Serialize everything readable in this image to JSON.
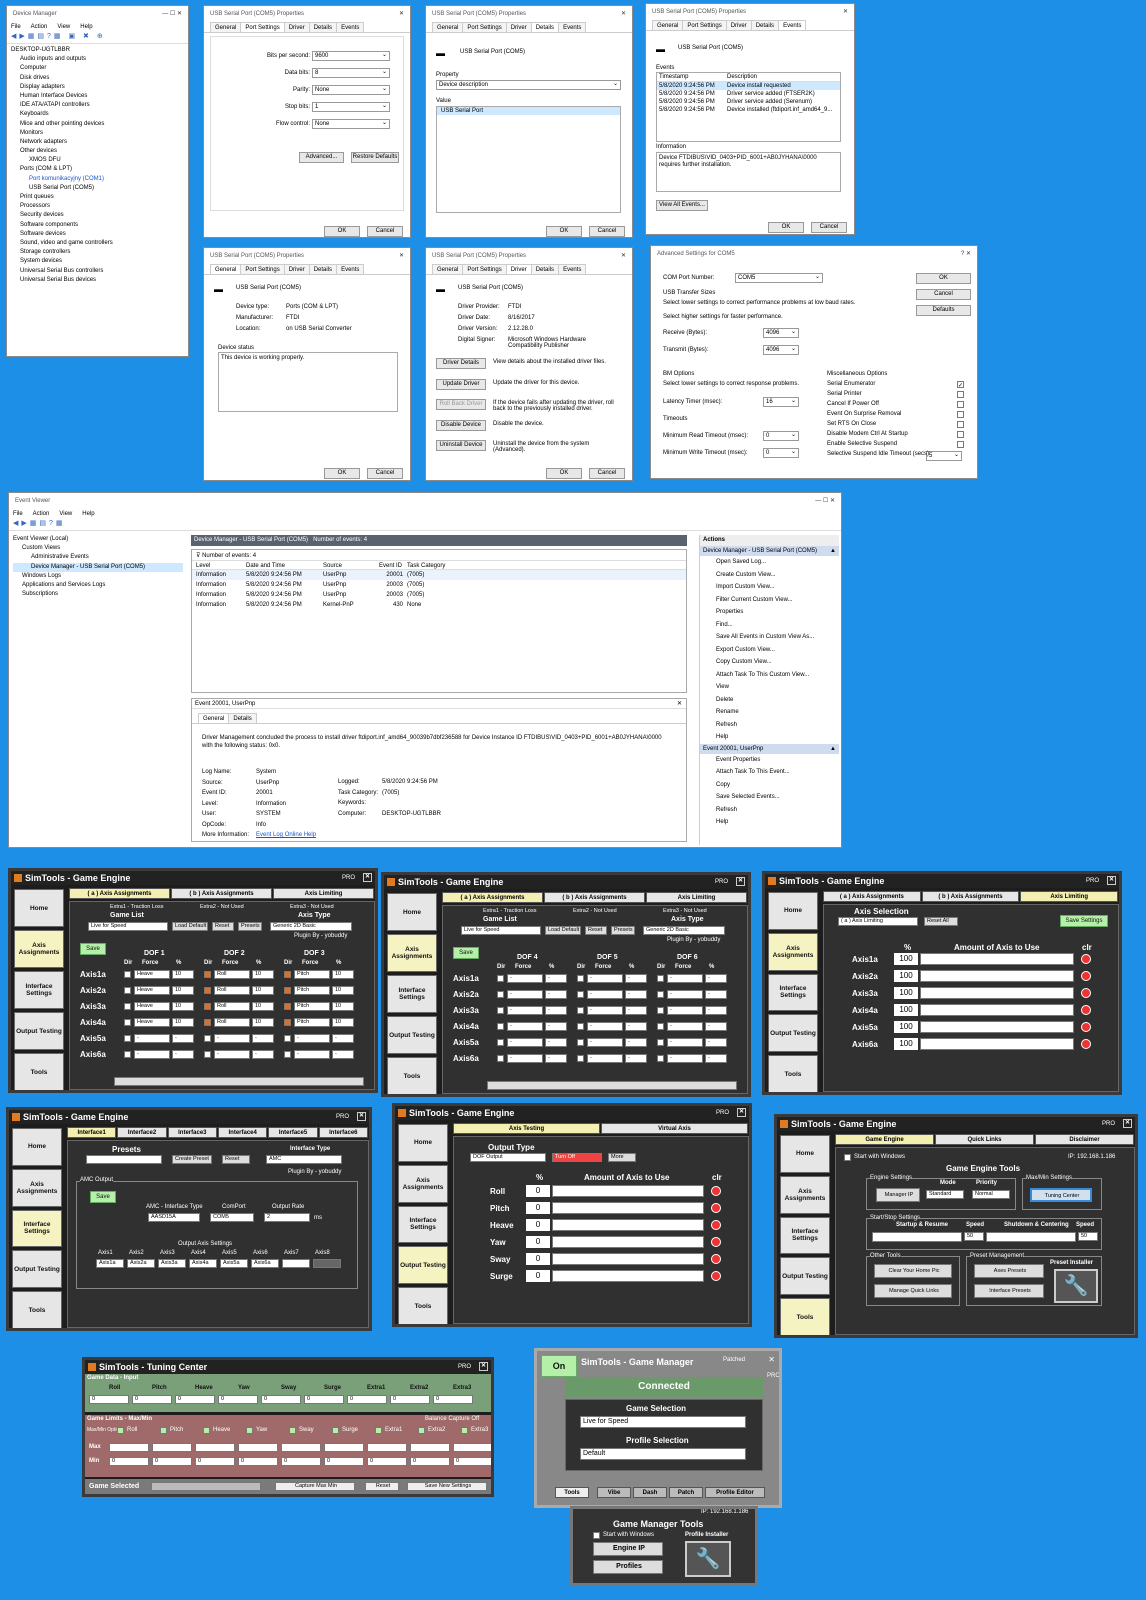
{
  "device_manager": {
    "title": "Device Manager",
    "menu": [
      "File",
      "Action",
      "View",
      "Help"
    ],
    "tree": [
      "DESKTOP-UGTLBBR",
      "Audio inputs and outputs",
      "Computer",
      "Disk drives",
      "Display adapters",
      "Human Interface Devices",
      "IDE ATA/ATAPI controllers",
      "Keyboards",
      "Mice and other pointing devices",
      "Monitors",
      "Network adapters",
      "Other devices",
      "XMOS DFU",
      "Ports (COM & LPT)",
      "Port komunikacyjny (COM1)",
      "USB Serial Port (COM5)",
      "Print queues",
      "Processors",
      "Security devices",
      "Software components",
      "Software devices",
      "Sound, video and game controllers",
      "Storage controllers",
      "System devices",
      "Universal Serial Bus controllers",
      "Universal Serial Bus devices"
    ]
  },
  "props_title": "USB Serial Port (COM5) Properties",
  "prop_tabs": [
    "General",
    "Port Settings",
    "Driver",
    "Details",
    "Events"
  ],
  "ok": "OK",
  "cancel": "Cancel",
  "port_settings": {
    "labels": [
      "Bits per second:",
      "Data bits:",
      "Parity:",
      "Stop bits:",
      "Flow control:"
    ],
    "values": [
      "9600",
      "8",
      "None",
      "1",
      "None"
    ],
    "advanced": "Advanced...",
    "restore": "Restore Defaults"
  },
  "details": {
    "device": "USB Serial Port (COM5)",
    "property_label": "Property",
    "property": "Device description",
    "value_label": "Value",
    "value": "USB Serial Port"
  },
  "events": {
    "device": "USB Serial Port (COM5)",
    "events_label": "Events",
    "col_ts": "Timestamp",
    "col_desc": "Description",
    "rows": [
      [
        "5/8/2020 9:24:56 PM",
        "Device install requested"
      ],
      [
        "5/8/2020 9:24:56 PM",
        "Driver service added (FTSER2K)"
      ],
      [
        "5/8/2020 9:24:56 PM",
        "Driver service added (Serenum)"
      ],
      [
        "5/8/2020 9:24:56 PM",
        "Device installed (ftdiport.inf_amd64_9..."
      ]
    ],
    "info_label": "Information",
    "info": "Device FTDIBUS\\VID_0403+PID_6001+AB0JYHANA\\0000 requires further installation.",
    "view_all": "View All Events..."
  },
  "general": {
    "device": "USB Serial Port (COM5)",
    "labels": [
      "Device type:",
      "Manufacturer:",
      "Location:"
    ],
    "values": [
      "Ports (COM & LPT)",
      "FTDI",
      "on USB Serial Converter"
    ],
    "status_label": "Device status",
    "status": "This device is working properly."
  },
  "driver": {
    "device": "USB Serial Port (COM5)",
    "labels": [
      "Driver Provider:",
      "Driver Date:",
      "Driver Version:",
      "Digital Signer:"
    ],
    "values": [
      "FTDI",
      "8/16/2017",
      "2.12.28.0",
      "Microsoft Windows Hardware Compatibility Publisher"
    ],
    "buttons": [
      "Driver Details",
      "Update Driver",
      "Roll Back Driver",
      "Disable Device",
      "Uninstall Device"
    ],
    "descs": [
      "View details about the installed driver files.",
      "Update the driver for this device.",
      "If the device fails after updating the driver, roll back to the previously installed driver.",
      "Disable the device.",
      "Uninstall the device from the system (Advanced)."
    ]
  },
  "advanced": {
    "title": "Advanced Settings for COM5",
    "com_label": "COM Port Number:",
    "com": "COM5",
    "usb_label": "USB Transfer Sizes",
    "usb_hint1": "Select lower settings to correct performance problems at low baud rates.",
    "usb_hint2": "Select higher settings for faster performance.",
    "receive": "Receive (Bytes):",
    "receive_v": "4096",
    "transmit": "Transmit (Bytes):",
    "transmit_v": "4096",
    "bm_label": "BM Options",
    "bm_hint": "Select lower settings to correct response problems.",
    "latency": "Latency Timer (msec):",
    "latency_v": "16",
    "timeouts": "Timeouts",
    "min_read": "Minimum Read Timeout (msec):",
    "min_read_v": "0",
    "min_write": "Minimum Write Timeout (msec):",
    "min_write_v": "0",
    "misc": "Miscellaneous Options",
    "misc_items": [
      "Serial Enumerator",
      "Serial Printer",
      "Cancel If Power Off",
      "Event On Surprise Removal",
      "Set RTS On Close",
      "Disable Modem Ctrl At Startup",
      "Enable Selective Suspend",
      "Selective Suspend Idle Timeout (secs):"
    ],
    "misc_v": "5",
    "buttons": [
      "OK",
      "Cancel",
      "Defaults"
    ]
  },
  "event_viewer": {
    "title": "Event Viewer",
    "menu": [
      "File",
      "Action",
      "View",
      "Help"
    ],
    "tree": [
      "Event Viewer (Local)",
      "Custom Views",
      "Administrative Events",
      "Device Manager - USB Serial Port (COM5)",
      "Windows Logs",
      "Applications and Services Logs",
      "Subscriptions"
    ],
    "header": "Device Manager - USB Serial Port (COM5)",
    "count_hdr": "Number of events: 4",
    "count": "Number of events: 4",
    "cols": [
      "Level",
      "Date and Time",
      "Source",
      "Event ID",
      "Task Category"
    ],
    "rows": [
      [
        "Information",
        "5/8/2020 9:24:56 PM",
        "UserPnp",
        "20001",
        "(7005)"
      ],
      [
        "Information",
        "5/8/2020 9:24:56 PM",
        "UserPnp",
        "20003",
        "(7005)"
      ],
      [
        "Information",
        "5/8/2020 9:24:56 PM",
        "UserPnp",
        "20003",
        "(7005)"
      ],
      [
        "Information",
        "5/8/2020 9:24:56 PM",
        "Kernel-PnP",
        "430",
        "None"
      ]
    ],
    "detail_title": "Event 20001, UserPnp",
    "detail_tabs": [
      "General",
      "Details"
    ],
    "detail_msg": "Driver Management concluded the process to install driver ftdiport.inf_amd64_90039b7dbf236588 for Device Instance ID FTDIBUS\\VID_0403+PID_6001+AB0JYHANA\\0000 with the following status: 0x0.",
    "fields": [
      [
        "Log Name:",
        "System"
      ],
      [
        "Source:",
        "UserPnp"
      ],
      [
        "Event ID:",
        "20001"
      ],
      [
        "Level:",
        "Information"
      ],
      [
        "User:",
        "SYSTEM"
      ],
      [
        "OpCode:",
        "Info"
      ],
      [
        "More Information:",
        "Event Log Online Help"
      ]
    ],
    "fields2": [
      [
        "Logged:",
        "5/8/2020 9:24:56 PM"
      ],
      [
        "Task Category:",
        "(7005)"
      ],
      [
        "Keywords:",
        ""
      ],
      [
        "Computer:",
        "DESKTOP-UGTLBBR"
      ]
    ],
    "actions_label": "Actions",
    "actions_hdr1": "Device Manager - USB Serial Port (COM5)",
    "actions1": [
      "Open Saved Log...",
      "Create Custom View...",
      "Import Custom View...",
      "Filter Current Custom View...",
      "Properties",
      "Find...",
      "Save All Events in Custom View As...",
      "Export Custom View...",
      "Copy Custom View...",
      "Attach Task To This Custom View...",
      "View",
      "Delete",
      "Rename",
      "Refresh",
      "Help"
    ],
    "actions_hdr2": "Event 20001, UserPnp",
    "actions2": [
      "Event Properties",
      "Attach Task To This Event...",
      "Copy",
      "Save Selected Events...",
      "Refresh",
      "Help"
    ]
  },
  "sim": {
    "title": "SimTools - Game Engine",
    "pro": "PRO",
    "side": [
      "Home",
      "Axis Assignments",
      "Interface Settings",
      "Output Testing",
      "Tools"
    ],
    "tabs": [
      "( a ) Axis Assignments",
      "( b ) Axis Assignments",
      "Axis Limiting"
    ],
    "extras1": [
      "Extra1 - Traction Loss",
      "Extra2 - Not Used",
      "Extra3 - Not Used"
    ],
    "game_list": "Game List",
    "game": "Live for Speed",
    "load_default": "Load Default",
    "reset": "Reset",
    "presets": "Presets",
    "axis_type": "Axis Type",
    "axis_type_v": "Generic 2D Basic",
    "plugin": "Plugin By - yobuddy",
    "save": "Save",
    "dof_a": [
      "DOF 1",
      "DOF 2",
      "DOF 3"
    ],
    "dof_b": [
      "DOF 4",
      "DOF 5",
      "DOF 6"
    ],
    "col": [
      "Dir",
      "Force",
      "%"
    ],
    "axes": [
      "Axis1a",
      "Axis2a",
      "Axis3a",
      "Axis4a",
      "Axis5a",
      "Axis6a"
    ],
    "forces": [
      [
        "Heave",
        "10",
        "Roll",
        "10",
        "Pitch",
        "10"
      ],
      [
        "Heave",
        "10",
        "Roll",
        "10",
        "Pitch",
        "10"
      ],
      [
        "Heave",
        "10",
        "Roll",
        "10",
        "Pitch",
        "10"
      ],
      [
        "Heave",
        "10",
        "Roll",
        "10",
        "Pitch",
        "10"
      ],
      [
        "-",
        "-",
        "-",
        "-",
        "-",
        "-"
      ],
      [
        "-",
        "-",
        "-",
        "-",
        "-",
        "-"
      ]
    ],
    "axis_sel": "Axis Selection",
    "axis_lim": "( a ) Axis Limiting",
    "reset_all": "Reset All",
    "save_settings": "Save Settings",
    "pct": "%",
    "amount": "Amount of Axis to Use",
    "clr": "clr",
    "hundred": "100",
    "itabs": [
      "Interface1",
      "Interface2",
      "Interface3",
      "Interface4",
      "Interface5",
      "Interface6"
    ],
    "iface_presets": "Presets",
    "create_preset": "Create Preset",
    "iface_type": "Interface Type",
    "iface_type_v": "AMC",
    "amc_output": "AMC Output",
    "amc_type": "AMC - Interface Type",
    "amc_type_v": "AASD15A",
    "comport": "ComPort",
    "comport_v": "COM5",
    "rate": "Output Rate",
    "rate_v": "2",
    "ms": "ms",
    "out_axis": "Output Axis Settings",
    "axis_cols": [
      "Axis1",
      "Axis2",
      "Axis3",
      "Axis4",
      "Axis5",
      "Axis6",
      "Axis7",
      "Axis8"
    ],
    "axis_vals": [
      "Axis1a",
      "Axis2a",
      "Axis3a",
      "Axis4a",
      "Axis5a",
      "Axis6a",
      "",
      ""
    ],
    "otabs": [
      "Axis Testing",
      "Virtual Axis"
    ],
    "output_type": "Output Type",
    "output_type_v": "DOF Output",
    "turn_off": "Turn Off",
    "more": "More",
    "dofs": [
      "Roll",
      "Pitch",
      "Heave",
      "Yaw",
      "Sway",
      "Surge"
    ],
    "zero": "0",
    "ttabs": [
      "Game Engine",
      "Quick Links",
      "Disclaimer"
    ],
    "start_win": "Start with Windows",
    "ip": "IP: 192.168.1.186",
    "ge_tools": "Game Engine Tools",
    "engine_settings": "Engine Settings",
    "manager_ip": "Manager IP",
    "mode": "Mode",
    "mode_v": "Standard",
    "priority": "Priority",
    "priority_v": "Normal",
    "maxmin": "Max/Min Settings",
    "tuning": "Tuning Center",
    "startstop": "Start/Stop Settings",
    "startup": "Startup & Resume",
    "shutdown": "Shutdown & Centering",
    "speed": "Speed",
    "fifty": "50",
    "other_tools": "Other Tools",
    "clear_pic": "Clear Your Home Pic",
    "manage_links": "Manage Quick Links",
    "preset_mgmt": "Preset Management",
    "axes_presets": "Axes Presets",
    "iface_presets2": "Interface Presets",
    "preset_installer": "Preset Installer"
  },
  "tuning": {
    "title": "SimTools - Tuning Center",
    "pro": "PRO",
    "game_data": "Game Data - Input",
    "cols": [
      "Roll",
      "Pitch",
      "Heave",
      "Yaw",
      "Sway",
      "Surge",
      "Extra1",
      "Extra2",
      "Extra3"
    ],
    "limits": "Game Limits - Max/Min",
    "balance": "Balance Capture Off",
    "maxmin_opt": "Max/Min Option",
    "max": "Max",
    "min": "Min",
    "zero": "0",
    "game_selected": "Game Selected",
    "capture": "Capture Max Min",
    "reset": "Reset",
    "save": "Save New Settings"
  },
  "manager": {
    "on": "On",
    "title": "SimTools - Game Manager",
    "patched": "Patched",
    "pro": "PRO",
    "connected": "Connected",
    "game_sel": "Game Selection",
    "game": "Live for Speed",
    "profile_sel": "Profile Selection",
    "profile": "Default",
    "tabs": [
      "Tools",
      "Vibe",
      "Dash",
      "Patch",
      "Profile Editor"
    ],
    "ip": "IP: 192.168.1.186",
    "tools_title": "Game Manager Tools",
    "start_win": "Start with Windows",
    "profile_installer": "Profile Installer",
    "engine_ip": "Engine IP",
    "profiles": "Profiles"
  },
  "colors": {
    "desktop": "#1e8fe6",
    "sim_bg": "#1d1d1d",
    "highlight_yellow": "#f6f3c2",
    "green": "#b5f0a8",
    "red": "#e33333"
  }
}
